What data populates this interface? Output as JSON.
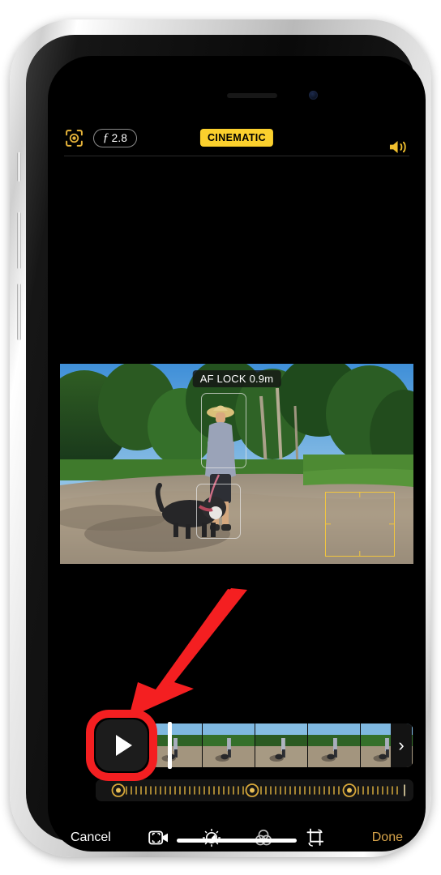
{
  "device": {
    "frame": "iphone-silver",
    "status_elements": [
      "speaker-grille",
      "front-camera",
      "home-indicator"
    ]
  },
  "camera_top_bar": {
    "cinematic_focus_icon": "cinematic-focus-icon",
    "aperture": {
      "symbol": "ƒ",
      "value": "2.8"
    },
    "mode_badge": "CINEMATIC",
    "audio_icon": "speaker-on-icon"
  },
  "preview": {
    "af_lock_label": "AF LOCK 0.9m",
    "subject_boxes": [
      "face-detection-box",
      "dog-detection-box"
    ],
    "manual_focus_box": "manual-focus-box"
  },
  "annotation": {
    "arrow": "red-pointer-arrow",
    "highlight": "red-highlight-ring",
    "points_to": "play-button"
  },
  "timeline": {
    "play_label": "play-triangle-icon",
    "frame_count": 5,
    "playhead_position_pct": 45,
    "expand_chevron": "›"
  },
  "focus_track": {
    "markers": [
      {
        "id": "focus-point-1",
        "position_pct": 18
      },
      {
        "id": "focus-point-2",
        "position_pct": 49
      },
      {
        "id": "focus-point-3",
        "position_pct": 80
      }
    ],
    "tick_count": 72,
    "accent_color": "#d8a83a"
  },
  "toolbar": {
    "cancel_label": "Cancel",
    "done_label": "Done",
    "items": [
      {
        "id": "cinematic-video-tool",
        "icon": "video-focus-icon",
        "active": true
      },
      {
        "id": "adjust-tool",
        "icon": "adjust-dial-icon",
        "active": false
      },
      {
        "id": "filters-tool",
        "icon": "filters-circles-icon",
        "active": false
      },
      {
        "id": "crop-rotate-tool",
        "icon": "crop-rotate-icon",
        "active": false
      }
    ]
  },
  "colors": {
    "accent_yellow": "#fbd02d",
    "focus_gold": "#f2c63f",
    "done_gold": "#d6a34a",
    "annotation_red": "#f41f21",
    "screen_black": "#000000"
  }
}
